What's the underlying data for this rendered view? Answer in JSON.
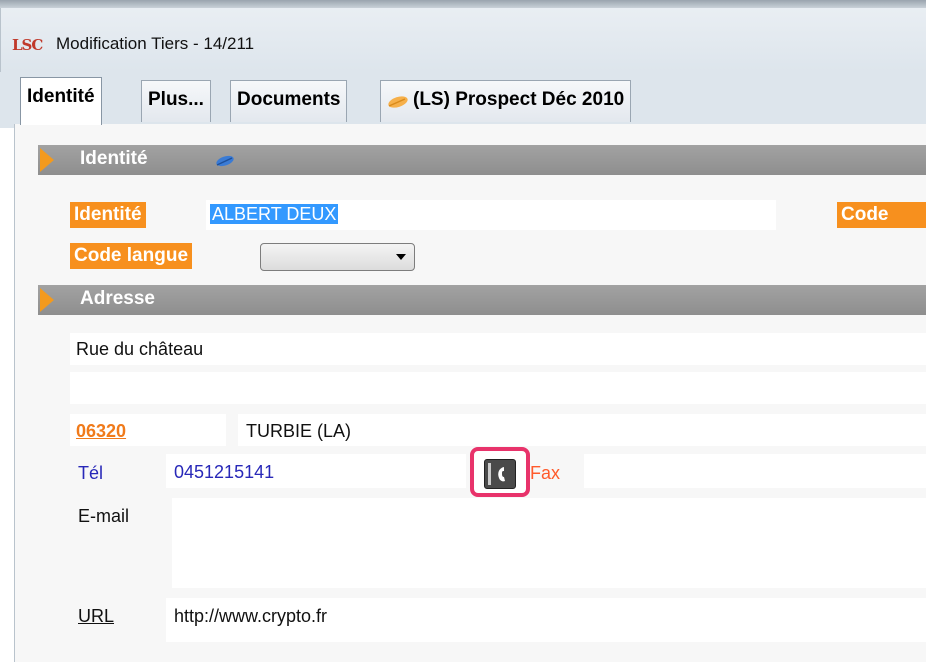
{
  "window": {
    "logo_text": "LSC",
    "title": "Modification Tiers - 14/211"
  },
  "tabs": [
    {
      "label": "Identité",
      "active": true
    },
    {
      "label": "Plus..."
    },
    {
      "label": "Documents"
    },
    {
      "label": "(LS) Prospect Déc 2010",
      "icon": "leaf-icon"
    }
  ],
  "identite_section": {
    "title": "Identité",
    "identite_label": "Identité",
    "identite_value": "ALBERT DEUX",
    "code_label": "Code",
    "code_langue_label": "Code langue",
    "code_langue_value": ""
  },
  "adresse_section": {
    "title": "Adresse",
    "address_line1": "Rue du château",
    "address_line2": "",
    "postal_code": "06320",
    "city": "TURBIE (LA)",
    "tel_label": "Tél",
    "tel_value": "0451215141",
    "fax_label": "Fax",
    "fax_value": "",
    "email_label": "E-mail",
    "email_value": "",
    "url_label": "URL",
    "url_value": "http://www.crypto.fr"
  },
  "colors": {
    "accent_orange": "#f7901e",
    "highlight": "#e8336b",
    "selection": "#3399ff",
    "section_bar": "#999999"
  }
}
